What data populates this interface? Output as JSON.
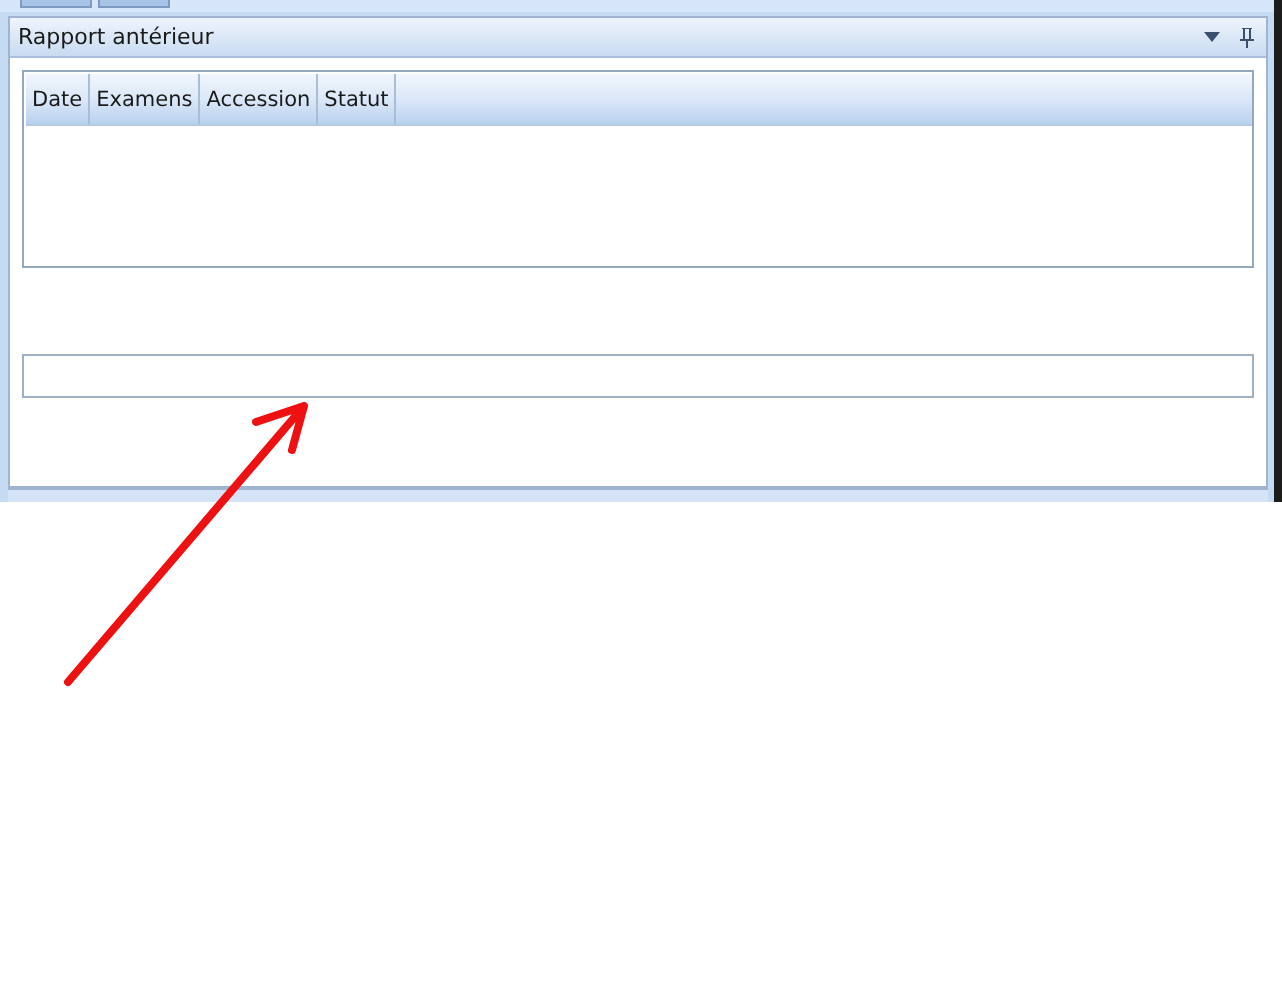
{
  "panel": {
    "title": "Rapport antérieur",
    "table": {
      "columns": [
        "Date",
        "Examens",
        "Accession",
        "Statut"
      ]
    }
  }
}
